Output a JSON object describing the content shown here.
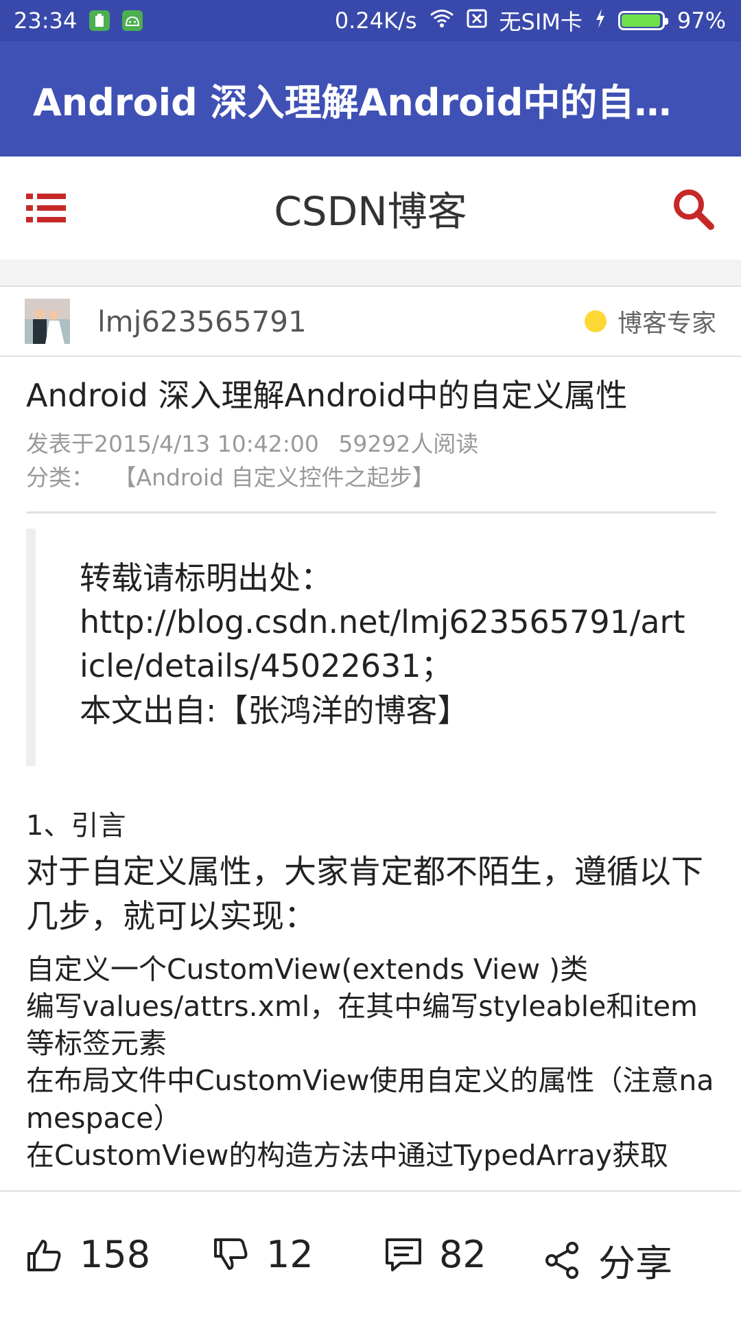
{
  "status_bar": {
    "time": "23:34",
    "network_speed": "0.24K/s",
    "sim": "无SIM卡",
    "battery": "97%",
    "battery_level": 0.97,
    "icons": [
      "sim-card-icon",
      "android-icon",
      "wifi-icon",
      "no-sim-icon",
      "charging-icon",
      "battery-icon"
    ]
  },
  "app_bar": {
    "title": "Android 深入理解Android中的自定..."
  },
  "site_header": {
    "title": "CSDN博客",
    "accent_color": "#c62828"
  },
  "author": {
    "name": "lmj623565791",
    "badge": "博客专家",
    "badge_color": "#fdd835"
  },
  "article": {
    "title": "Android 深入理解Android中的自定义属性",
    "published": "发表于2015/4/13 10:42:00",
    "reads": "59292人阅读",
    "category_label": "分类：",
    "category": "【Android 自定义控件之起步】",
    "quote": {
      "line1": "转载请标明出处：",
      "line2": "http://blog.csdn.net/lmj623565791/article/details/45022631；",
      "line3": "本文出自:【张鸿洋的博客】"
    },
    "section_heading": "1、引言",
    "lead": "对于自定义属性，大家肯定都不陌生，遵循以下几步，就可以实现：",
    "steps": [
      "自定义一个CustomView(extends View )类",
      "编写values/attrs.xml，在其中编写styleable和item等标签元素",
      "在布局文件中CustomView使用自定义的属性（注意namespace）",
      "在CustomView的构造方法中通过TypedArray获取"
    ]
  },
  "actions": {
    "likes": "158",
    "dislikes": "12",
    "comments": "82",
    "share": "分享"
  }
}
